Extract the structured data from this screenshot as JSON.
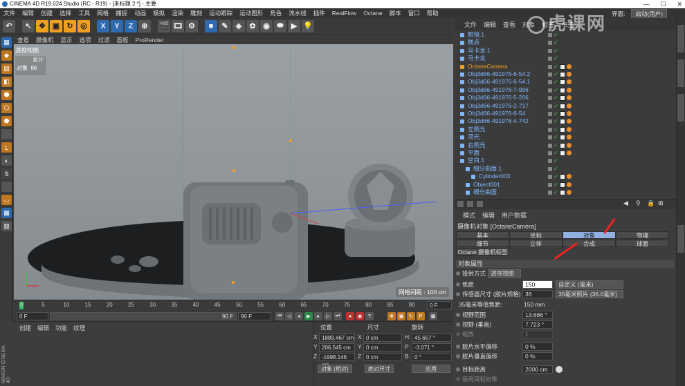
{
  "window": {
    "title": "CINEMA 4D R19.024 Studio (RC - R19) - [未标题 2 *] - 主要",
    "controls": [
      "—",
      "☐",
      "✕"
    ]
  },
  "menubar": {
    "items": [
      "文件",
      "编辑",
      "创建",
      "选择",
      "工具",
      "网格",
      "捕捉",
      "动画",
      "模拟",
      "渲染",
      "雕刻",
      "运动跟踪",
      "运动图形",
      "角色",
      "流水线",
      "插件",
      "RealFlow",
      "Octane",
      "脚本",
      "窗口",
      "帮助"
    ],
    "layout_label": "界面:",
    "layout_value": "启动(用户)"
  },
  "toolbar": {
    "axis_x": "X",
    "axis_y": "Y",
    "axis_z": "Z"
  },
  "viewport": {
    "menu": [
      "查看",
      "摄像机",
      "显示",
      "选项",
      "过滤",
      "面板",
      "ProRender"
    ],
    "label": "透视视图",
    "stats_total": "总计",
    "stats_objects_label": "对象",
    "stats_objects_value": "86",
    "grid_readout": "网格间距 : 100 cm"
  },
  "timeline": {
    "ticks": [
      "0",
      "5",
      "10",
      "15",
      "20",
      "25",
      "30",
      "35",
      "40",
      "45",
      "50",
      "55",
      "60",
      "65",
      "70",
      "75",
      "80",
      "85",
      "90"
    ],
    "current_frame": "0 F"
  },
  "playbar": {
    "start": "0 F",
    "range_end": "90 F",
    "end": "90 F"
  },
  "material_panel": {
    "menu": [
      "创建",
      "编辑",
      "功能",
      "纹理"
    ],
    "brand": "MAXON CINEMA 4D"
  },
  "coord_panel": {
    "headers": [
      "位置",
      "尺寸",
      "旋转"
    ],
    "rows": [
      {
        "axis": "X",
        "pos": "1889.467 cm",
        "size": "0 cm",
        "rot_axis": "H",
        "rot": "45.657 °"
      },
      {
        "axis": "Y",
        "pos": "206.545 cm",
        "size": "0 cm",
        "rot_axis": "P",
        "rot": "-3.071 °"
      },
      {
        "axis": "Z",
        "pos": "-1998.146 cm",
        "size": "0 cm",
        "rot_axis": "B",
        "rot": "0 °"
      }
    ],
    "mode_object": "对象 (相对)",
    "mode_size": "绝对尺寸",
    "apply": "应用"
  },
  "object_manager": {
    "menu": [
      "文件",
      "编辑",
      "查看",
      "对象",
      "标签",
      "书签"
    ],
    "items": [
      {
        "name": "眼镜.1",
        "indent": 0,
        "color": "#7fb7ff"
      },
      {
        "name": "糕点",
        "indent": 0,
        "color": "#7fb7ff"
      },
      {
        "name": "马卡龙.1",
        "indent": 0,
        "color": "#7fb7ff"
      },
      {
        "name": "马卡龙",
        "indent": 0,
        "color": "#7fb7ff"
      },
      {
        "name": "OctaneCamera",
        "indent": 0,
        "color": "#f0a020"
      },
      {
        "name": "Obj3d66-491976-6-54.2",
        "indent": 0,
        "color": "#7fb7ff"
      },
      {
        "name": "Obj3d66-491976-6-54.1",
        "indent": 0,
        "color": "#7fb7ff"
      },
      {
        "name": "Obj3d66-491976-7-996",
        "indent": 0,
        "color": "#7fb7ff"
      },
      {
        "name": "Obj3d66-491976-5-206",
        "indent": 0,
        "color": "#7fb7ff"
      },
      {
        "name": "Obj3d66-491976-2-717",
        "indent": 0,
        "color": "#7fb7ff"
      },
      {
        "name": "Obj3d66-491976-6-54",
        "indent": 0,
        "color": "#7fb7ff"
      },
      {
        "name": "Obj3d66-491976-4-742",
        "indent": 0,
        "color": "#7fb7ff"
      },
      {
        "name": "左侧光",
        "indent": 0,
        "color": "#7fb7ff"
      },
      {
        "name": "顶光",
        "indent": 0,
        "color": "#7fb7ff"
      },
      {
        "name": "右侧光",
        "indent": 0,
        "color": "#7fb7ff"
      },
      {
        "name": "平面",
        "indent": 0,
        "color": "#7fb7ff"
      },
      {
        "name": "空白.1",
        "indent": 0,
        "color": "#7fb7ff"
      },
      {
        "name": "细分曲面.1",
        "indent": 1,
        "color": "#7fb7ff"
      },
      {
        "name": "Cylinder003",
        "indent": 2,
        "color": "#7fb7ff"
      },
      {
        "name": "Object001",
        "indent": 1,
        "color": "#7fb7ff"
      },
      {
        "name": "细分曲面",
        "indent": 1,
        "color": "#7fb7ff"
      }
    ]
  },
  "attributes": {
    "menu": [
      "模式",
      "编辑",
      "用户数据"
    ],
    "title": "摄像机对象 [OctaneCamera]",
    "tabs_row1": [
      "基本",
      "坐标",
      "对象",
      "物理"
    ],
    "tabs_row2": [
      "细节",
      "立体",
      "合成",
      "球面"
    ],
    "octane_tab": "Octane 摄像机标签",
    "section": "对象属性",
    "projection_label": "投射方式",
    "projection_value": "透视视图",
    "focal_label": "焦距",
    "focal_value": "150",
    "focal_preset": "自定义 (毫米)",
    "sensor_label": "传感器尺寸 (胶片规格)",
    "sensor_value": "36",
    "sensor_preset": "35毫米照片 (36.0毫米)",
    "equiv_label": "35毫米等值焦距:",
    "equiv_value": "150 mm",
    "fov_h_label": "视野范围",
    "fov_h_value": "13.686 °",
    "fov_v_label": "视野 (垂直)",
    "fov_v_value": "7.723 °",
    "zoom_label": "缩放",
    "zoom_value": "1",
    "offset_x_label": "胶片水平偏移",
    "offset_x_value": "0 %",
    "offset_y_label": "胶片垂直偏移",
    "offset_y_value": "0 %",
    "target_label": "目标距离",
    "target_value": "2000 cm",
    "use_target_label": "使用目标对象"
  },
  "watermark": "虎课网"
}
